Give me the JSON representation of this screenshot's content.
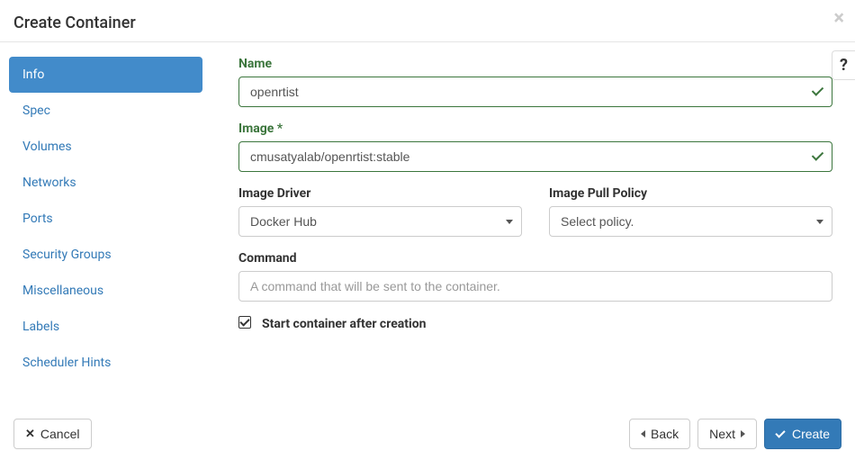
{
  "header": {
    "title": "Create Container"
  },
  "sidebar": {
    "items": [
      {
        "label": "Info",
        "active": true
      },
      {
        "label": "Spec"
      },
      {
        "label": "Volumes"
      },
      {
        "label": "Networks"
      },
      {
        "label": "Ports"
      },
      {
        "label": "Security Groups"
      },
      {
        "label": "Miscellaneous"
      },
      {
        "label": "Labels"
      },
      {
        "label": "Scheduler Hints"
      }
    ]
  },
  "form": {
    "name": {
      "label": "Name",
      "value": "openrtist"
    },
    "image": {
      "label": "Image",
      "required": "*",
      "value": "cmusatyalab/openrtist:stable"
    },
    "image_driver": {
      "label": "Image Driver",
      "value": "Docker Hub"
    },
    "image_pull_policy": {
      "label": "Image Pull Policy",
      "value": "Select policy."
    },
    "command": {
      "label": "Command",
      "placeholder": "A command that will be sent to the container."
    },
    "start_after": {
      "label": "Start container after creation",
      "checked": true
    }
  },
  "footer": {
    "cancel": "Cancel",
    "back": "Back",
    "next": "Next",
    "create": "Create"
  }
}
